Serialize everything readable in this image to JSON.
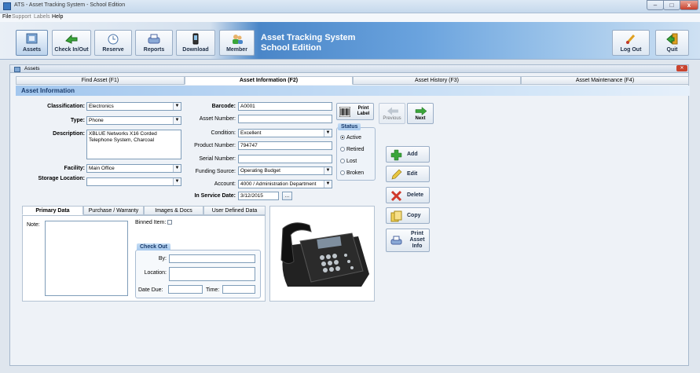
{
  "window": {
    "title": "ATS - Asset Tracking System - School Edition",
    "minimize": "–",
    "maximize": "□",
    "close": "x"
  },
  "menu": [
    "File",
    "Support",
    "Labels",
    "Help"
  ],
  "toolbar": {
    "buttons": [
      {
        "label": "Assets",
        "icon": "assets-icon"
      },
      {
        "label": "Check In/Out",
        "icon": "check-in-out-icon"
      },
      {
        "label": "Reserve",
        "icon": "reserve-icon"
      },
      {
        "label": "Reports",
        "icon": "reports-icon"
      },
      {
        "label": "Download",
        "icon": "download-icon"
      },
      {
        "label": "Member",
        "icon": "member-icon"
      }
    ],
    "system_title_line1": "Asset Tracking System",
    "system_title_line2": "School Edition",
    "log_out": "Log Out",
    "quit": "Quit"
  },
  "panel": {
    "title": "Assets"
  },
  "tabs": [
    "Find Asset (F1)",
    "Asset Information (F2)",
    "Asset History (F3)",
    "Asset Maintenance (F4)"
  ],
  "section_title": "Asset Information",
  "form": {
    "classification_label": "Classification:",
    "classification": "Electronics",
    "type_label": "Type:",
    "type": "Phone",
    "description_label": "Description:",
    "description": "XBLUE Networks X16 Corded Telephone System, Charcoal",
    "facility_label": "Facility:",
    "facility": "Main Office",
    "storage_label": "Storage Location:",
    "storage": "",
    "barcode_label": "Barcode:",
    "barcode": "A0001",
    "asset_number_label": "Asset Number:",
    "asset_number": "",
    "condition_label": "Condition:",
    "condition": "Excellent",
    "product_number_label": "Product Number:",
    "product_number": "794747",
    "serial_number_label": "Serial Number:",
    "serial_number": "",
    "funding_source_label": "Funding Source:",
    "funding_source": "Operating Budget",
    "account_label": "Account:",
    "account": "4000 / Administration Department",
    "in_service_label": "In Service Date:",
    "in_service": "3/12/2015",
    "date_picker_label": "..."
  },
  "print_label": "Print Label",
  "status": {
    "title": "Status",
    "options": [
      "Active",
      "Retired",
      "Lost",
      "Broken"
    ],
    "selected": "Active"
  },
  "nav": {
    "previous": "Previous",
    "next": "Next"
  },
  "actions": [
    "Add",
    "Edit",
    "Delete",
    "Copy",
    "Print Asset Info"
  ],
  "inner_tabs": [
    "Primary Data",
    "Purchase / Warranty",
    "Images & Docs",
    "User Defined Data"
  ],
  "primary": {
    "note_label": "Note:",
    "binned_label": "Binned Item:",
    "checkout_title": "Check Out",
    "by_label": "By:",
    "location_label": "Location:",
    "date_due_label": "Date Due:",
    "time_label": "Time:"
  },
  "colors": {
    "accent": "#4a86c8",
    "section": "#a3c7ee",
    "delete": "#d0392b",
    "add": "#3aa53a"
  }
}
